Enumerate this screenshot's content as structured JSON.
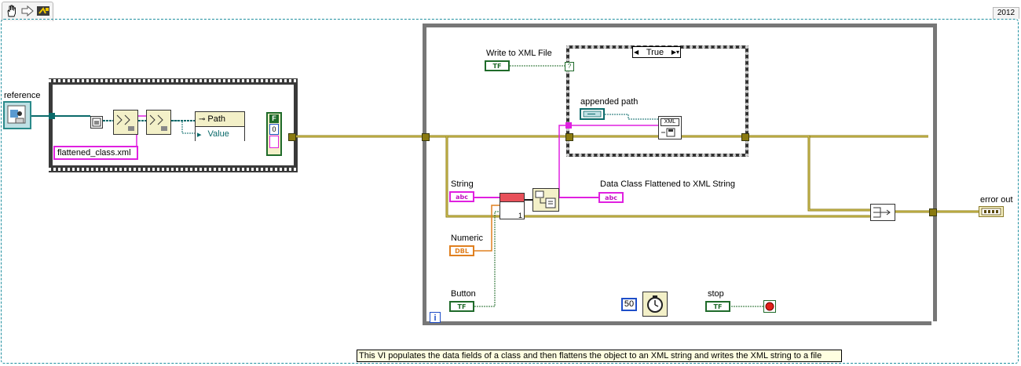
{
  "toolbar": {
    "hand_icon": "hand-tool-icon",
    "arrow_icon": "run-arrow-icon",
    "probe_icon": "probe-icon"
  },
  "version": "2012",
  "controls": {
    "reference": "reference",
    "flattened_file": "flattened_class.xml",
    "write_to_xml": "Write to XML File",
    "appended_path": "appended path",
    "string": "String",
    "numeric": "Numeric",
    "button": "Button",
    "stop": "stop",
    "data_class_flattened": "Data Class Flattened to XML String",
    "error_out": "error out"
  },
  "case_selector": "True",
  "path_node": {
    "path": "Path",
    "value": "Value"
  },
  "bool_const": "F",
  "index_const": "0",
  "wait_ms": "50",
  "loop_iteration": "i",
  "bundle_index": "1",
  "terminal_types": {
    "tf": "TF",
    "abc": "abc",
    "dbl": "DBL"
  },
  "xml_node_label": "XML",
  "description": "This VI populates the data fields of a class and then flattens the object to an XML string and writes the XML string to a file",
  "colors": {
    "error_wire": "#8a7a10",
    "string_wire": "#e020e0",
    "bool_wire": "#1f6b2a",
    "numeric_wire": "#e08020",
    "class_wire": "#0a6a6a"
  }
}
